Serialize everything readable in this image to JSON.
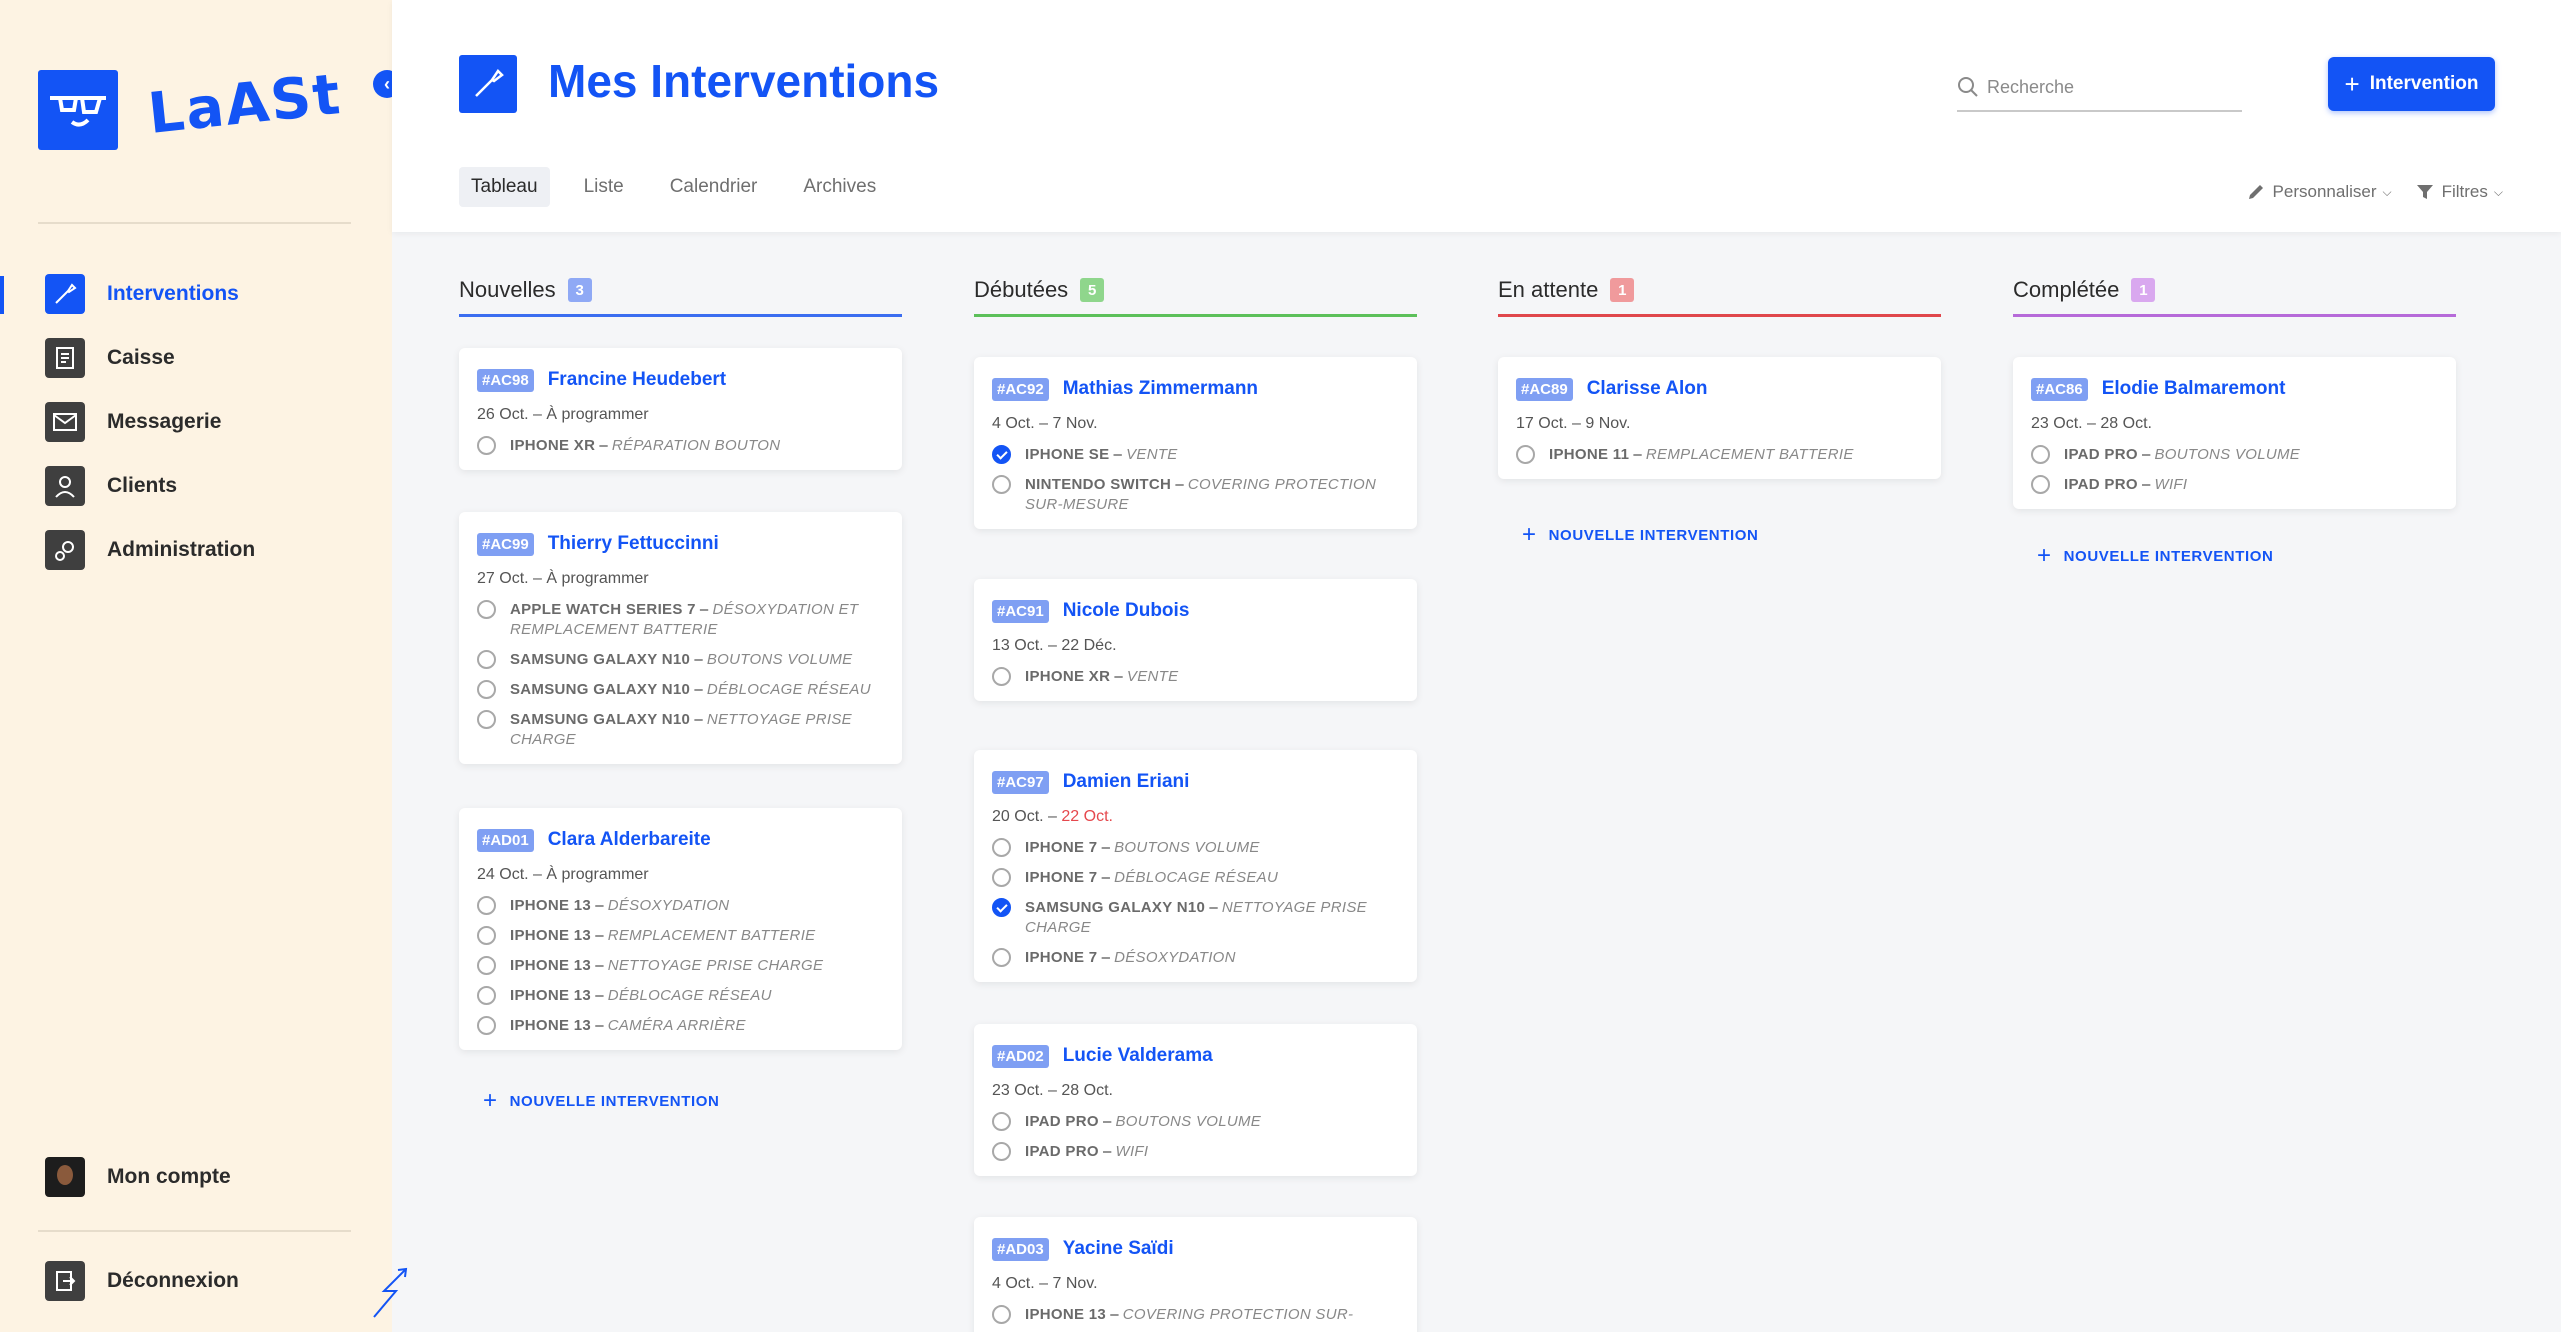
{
  "brand": {
    "logo_text": "LaASt"
  },
  "sidebar": {
    "items": [
      {
        "label": "Interventions",
        "icon": "wrench-icon",
        "active": true
      },
      {
        "label": "Caisse",
        "icon": "cash-register-icon",
        "active": false
      },
      {
        "label": "Messagerie",
        "icon": "mail-icon",
        "active": false
      },
      {
        "label": "Clients",
        "icon": "user-icon",
        "active": false
      },
      {
        "label": "Administration",
        "icon": "gears-icon",
        "active": false
      }
    ],
    "account_label": "Mon compte",
    "logout_label": "Déconnexion"
  },
  "header": {
    "title": "Mes Interventions",
    "search_placeholder": "Recherche",
    "new_button_label": "Intervention",
    "tabs": [
      "Tableau",
      "Liste",
      "Calendrier",
      "Archives"
    ],
    "active_tab": "Tableau",
    "customize_label": "Personnaliser",
    "filters_label": "Filtres"
  },
  "add_intervention_label": "NOUVELLE INTERVENTION",
  "columns": [
    {
      "title": "Nouvelles",
      "count": "3",
      "color": "#3b6df0",
      "badge_color": "#8fa9f5",
      "cards": [
        {
          "ref": "#AC98",
          "client": "Francine Heudebert",
          "date_start": "26 Oct. – ",
          "date_end": "À programmer",
          "late": false,
          "tasks": [
            {
              "device": "iPhone XR",
              "action": "Réparation bouton",
              "done": false
            }
          ]
        },
        {
          "ref": "#AC99",
          "client": "Thierry Fettuccinni",
          "date_start": "27 Oct. – ",
          "date_end": "À programmer",
          "late": false,
          "tasks": [
            {
              "device": "Apple Watch Series 7",
              "action": "Désoxydation et remplacement batterie",
              "done": false
            },
            {
              "device": "Samsung Galaxy N10",
              "action": "Boutons volume",
              "done": false
            },
            {
              "device": "Samsung Galaxy N10",
              "action": "Déblocage réseau",
              "done": false
            },
            {
              "device": "Samsung Galaxy N10",
              "action": "Nettoyage prise charge",
              "done": false
            }
          ]
        },
        {
          "ref": "#AD01",
          "client": "Clara Alderbareite",
          "date_start": "24 Oct. – ",
          "date_end": "À programmer",
          "late": false,
          "tasks": [
            {
              "device": "iPhone 13",
              "action": "Désoxydation",
              "done": false
            },
            {
              "device": "iPhone 13",
              "action": "Remplacement batterie",
              "done": false
            },
            {
              "device": "iPhone 13",
              "action": "Nettoyage prise charge",
              "done": false
            },
            {
              "device": "iPhone 13",
              "action": "Déblocage réseau",
              "done": false
            },
            {
              "device": "iPhone 13",
              "action": "Caméra arrière",
              "done": false
            }
          ]
        }
      ]
    },
    {
      "title": "Débutées",
      "count": "5",
      "color": "#5cc05a",
      "badge_color": "#8fd68c",
      "cards": [
        {
          "ref": "#AC92",
          "client": "Mathias Zimmermann",
          "date_start": "4 Oct. – ",
          "date_end": "7 Nov.",
          "late": false,
          "tasks": [
            {
              "device": "iPhone SE",
              "action": "Vente",
              "done": true
            },
            {
              "device": "Nintendo Switch",
              "action": "Covering protection sur-mesure",
              "done": false
            }
          ]
        },
        {
          "ref": "#AC91",
          "client": "Nicole Dubois",
          "date_start": "13 Oct. – ",
          "date_end": "22 Déc.",
          "late": false,
          "tasks": [
            {
              "device": "iPhone XR",
              "action": "Vente",
              "done": false
            }
          ]
        },
        {
          "ref": "#AC97",
          "client": "Damien Eriani",
          "date_start": "20 Oct. – ",
          "date_end": "22 Oct.",
          "late": true,
          "tasks": [
            {
              "device": "iPhone 7",
              "action": "Boutons volume",
              "done": false
            },
            {
              "device": "iPhone 7",
              "action": "Déblocage réseau",
              "done": false
            },
            {
              "device": "Samsung Galaxy N10",
              "action": "Nettoyage prise charge",
              "done": true
            },
            {
              "device": "iPhone 7",
              "action": "Désoxydation",
              "done": false
            }
          ]
        },
        {
          "ref": "#AD02",
          "client": "Lucie Valderama",
          "date_start": "23 Oct. – ",
          "date_end": "28 Oct.",
          "late": false,
          "tasks": [
            {
              "device": "iPad Pro",
              "action": "Boutons volume",
              "done": false
            },
            {
              "device": "iPad Pro",
              "action": "Wifi",
              "done": false
            }
          ]
        },
        {
          "ref": "#AD03",
          "client": "Yacine Saïdi",
          "date_start": "4 Oct. – ",
          "date_end": "7 Nov.",
          "late": false,
          "tasks": [
            {
              "device": "iPhone 13",
              "action": "Covering protection sur-",
              "done": false
            }
          ]
        }
      ]
    },
    {
      "title": "En attente",
      "count": "1",
      "color": "#e0474c",
      "badge_color": "#f09a9c",
      "cards": [
        {
          "ref": "#AC89",
          "client": "Clarisse Alon",
          "date_start": "17 Oct. – ",
          "date_end": "9  Nov.",
          "late": false,
          "tasks": [
            {
              "device": "iPhone 11",
              "action": "Remplacement batterie",
              "done": false
            }
          ]
        }
      ]
    },
    {
      "title": "Complétée",
      "count": "1",
      "color": "#b66ad9",
      "badge_color": "#d9a8ef",
      "cards": [
        {
          "ref": "#AC86",
          "client": "Elodie Balmaremont",
          "date_start": "23 Oct. – ",
          "date_end": "28 Oct.",
          "late": false,
          "tasks": [
            {
              "device": "iPad Pro",
              "action": "Boutons volume",
              "done": false
            },
            {
              "device": "iPad Pro",
              "action": "Wifi",
              "done": false
            }
          ]
        }
      ]
    }
  ]
}
